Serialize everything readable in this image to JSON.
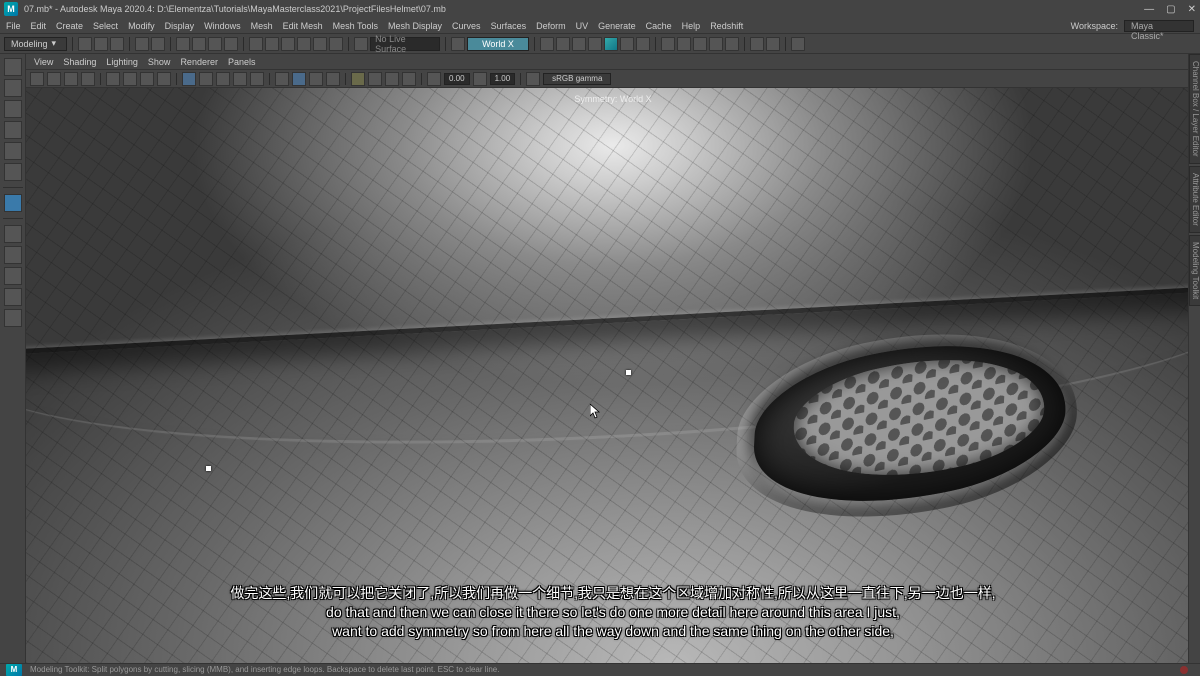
{
  "titlebar": {
    "logo": "M",
    "filename": "07.mb*",
    "app": "Autodesk Maya 2020.4",
    "path": "D:\\Elementza\\Tutorials\\MayaMasterclass2021\\ProjectFilesHelmet\\07.mb",
    "full_title": "07.mb* - Autodesk Maya 2020.4: D:\\Elementza\\Tutorials\\MayaMasterclass2021\\ProjectFilesHelmet\\07.mb"
  },
  "menubar": {
    "items": [
      "File",
      "Edit",
      "Create",
      "Select",
      "Modify",
      "Display",
      "Windows",
      "Mesh",
      "Edit Mesh",
      "Mesh Tools",
      "Mesh Display",
      "Curves",
      "Surfaces",
      "Deform",
      "UV",
      "Generate",
      "Cache",
      "Help",
      "Redshift"
    ],
    "workspace_label": "Workspace:",
    "workspace_value": "Maya Classic*"
  },
  "shelf": {
    "mode": "Modeling",
    "live": "No Live Surface",
    "symmetry": "World X"
  },
  "viewmenu": {
    "items": [
      "View",
      "Shading",
      "Lighting",
      "Show",
      "Renderer",
      "Panels"
    ]
  },
  "viewtoolbar": {
    "field1": "0.00",
    "field2": "1.00",
    "gamma": "sRGB gamma"
  },
  "viewport": {
    "hud": "Symmetry: World X"
  },
  "rightbar": {
    "tabs": [
      "Channel Box / Layer Editor",
      "Attribute Editor",
      "Modeling Toolkit"
    ]
  },
  "subtitles": {
    "line_cn": "做完这些,我们就可以把它关闭了,所以我们再做一个细节,我只是想在这个区域增加对称性,所以从这里一直往下,另一边也一样,",
    "line_en1": "do that and then we can close it there so let's do one more detail here around this area I just,",
    "line_en2": "want to add symmetry so from here all the way down and the same thing on the other side,"
  },
  "statusbar": {
    "text": "Modeling Toolkit: Split polygons by cutting, slicing (MMB), and inserting edge loops. Backspace to delete last point. ESC to clear line."
  }
}
